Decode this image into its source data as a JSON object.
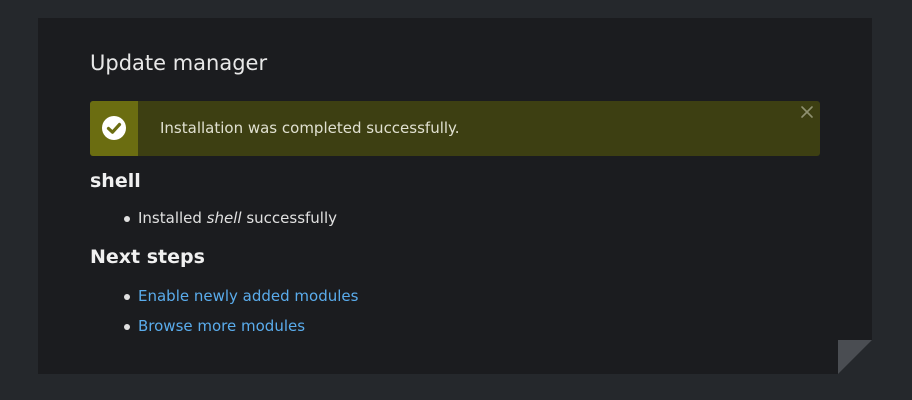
{
  "page": {
    "title": "Update manager"
  },
  "message": {
    "status": "success",
    "icon": "check-circle-icon",
    "text": "Installation was completed successfully.",
    "close_icon": "close-icon",
    "colors": {
      "background": "#3d3f12",
      "icon_background": "#6b6d11"
    }
  },
  "module": {
    "name": "shell",
    "results": [
      {
        "prefix": "Installed ",
        "module": "shell",
        "suffix": " successfully"
      }
    ]
  },
  "next_steps": {
    "heading": "Next steps",
    "links": [
      {
        "label": "Enable newly added modules"
      },
      {
        "label": "Browse more modules"
      }
    ]
  },
  "colors": {
    "page_background": "#25282c",
    "panel_background": "#1b1c1f",
    "link": "#5aacec"
  }
}
